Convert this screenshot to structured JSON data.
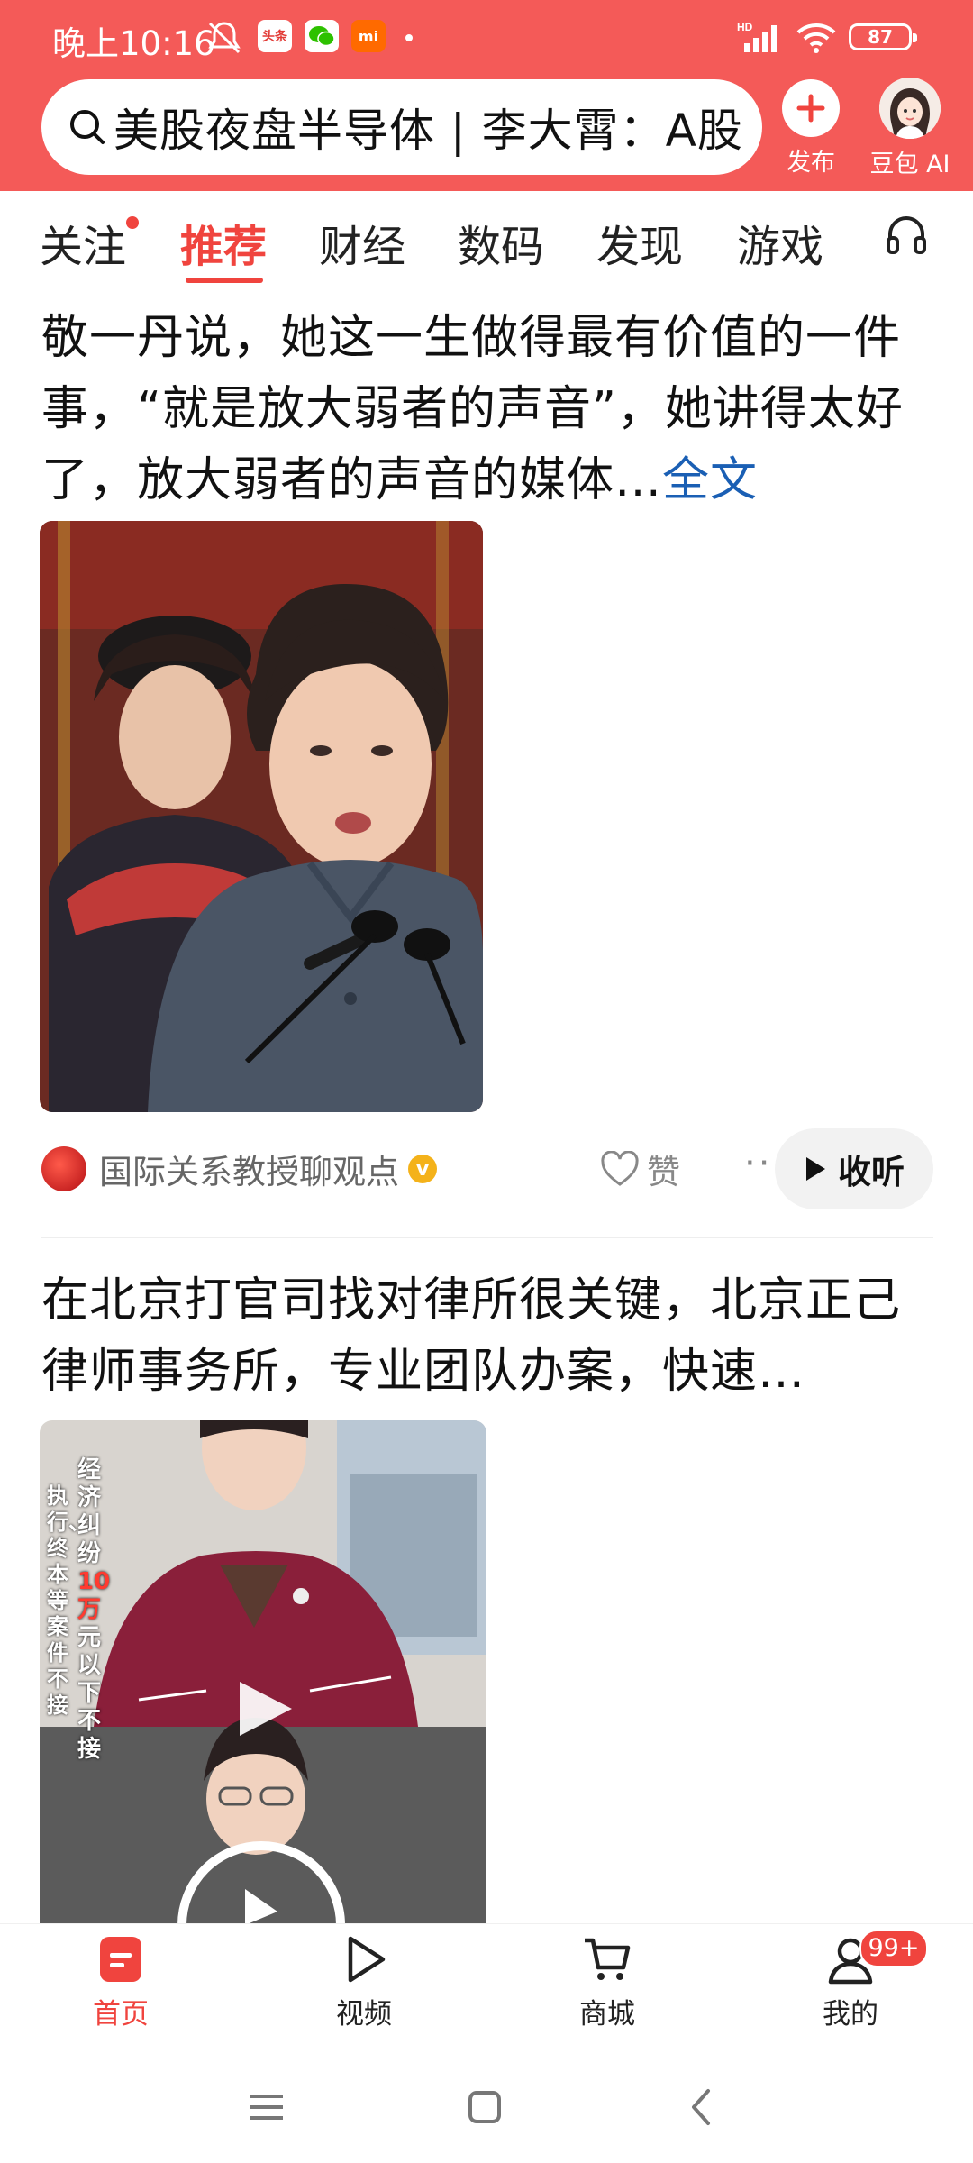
{
  "status_bar": {
    "time": "晚上10:16",
    "app_icon_toutiao": "头条",
    "app_icon_mi": "mi",
    "battery": "87",
    "hd_label": "HD"
  },
  "search": {
    "query": "美股夜盘半导体 | 李大霄：A股"
  },
  "top_actions": {
    "publish_label": "发布",
    "doubao_label": "豆包 AI"
  },
  "tabs": [
    {
      "label": "关注",
      "has_dot": true
    },
    {
      "label": "推荐",
      "active": true
    },
    {
      "label": "财经"
    },
    {
      "label": "数码"
    },
    {
      "label": "发现"
    },
    {
      "label": "游戏"
    }
  ],
  "feed": [
    {
      "title": "敬一丹说，她这一生做得最有价值的一件事，“就是放大弱者的声音”，她讲得太好了，放大弱者的声音的媒体…",
      "more_link": "全文",
      "source": "国际关系教授聊观点",
      "verified_mark": "v",
      "like_label": "赞",
      "listen_label": "收听"
    },
    {
      "title": "在北京打官司找对律所很关键，北京正己律师事务所，专业团队办案，快速…",
      "video_caption_col1": "经济纠纷",
      "video_caption_highlight": "10万",
      "video_caption_col1_tail": "元以下不接",
      "video_caption_col2": "执行、终本等案件不接"
    }
  ],
  "bottom_nav": [
    {
      "label": "首页",
      "icon": "home-icon",
      "active": true
    },
    {
      "label": "视频",
      "icon": "video-play-icon"
    },
    {
      "label": "商城",
      "icon": "cart-icon"
    },
    {
      "label": "我的",
      "icon": "user-icon",
      "badge": "99+"
    }
  ],
  "colors": {
    "brand_red": "#f45a58",
    "accent_red": "#f0443e",
    "link_blue": "#1a5fb4"
  }
}
